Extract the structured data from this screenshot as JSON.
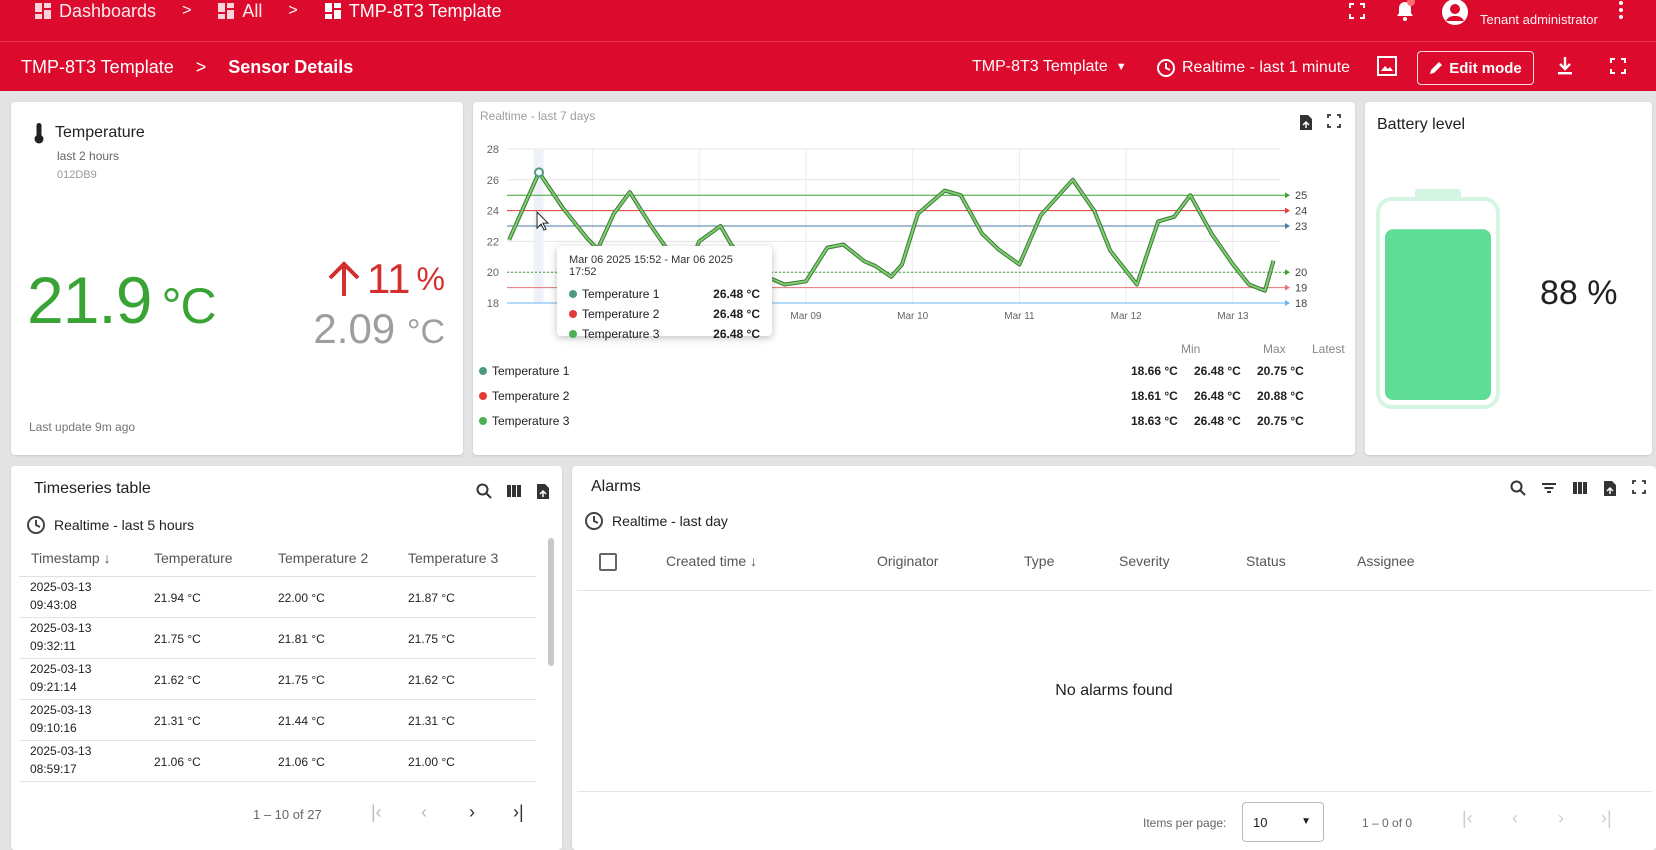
{
  "topbar": {
    "crumbs": [
      "Dashboards",
      "All",
      "TMP-8T3 Template"
    ],
    "user_role": "Tenant administrator"
  },
  "subbar": {
    "root": "TMP-8T3 Template",
    "current": "Sensor Details",
    "entity_select": "TMP-8T3 Template",
    "timewindow": "Realtime - last 1 minute",
    "edit_mode_label": "Edit mode"
  },
  "temperature_card": {
    "title": "Temperature",
    "subtitle": "last 2 hours",
    "device": "012DB9",
    "value": "21.9",
    "unit": "°C",
    "delta_percent": "11",
    "percent_sign": "%",
    "delta_abs": "2.09",
    "delta_unit": "°C",
    "last_update": "Last update 9m ago",
    "colors": {
      "value": "#3aa335",
      "delta": "#d32f2f"
    }
  },
  "chart_card": {
    "timewindow": "Realtime - last 7 days",
    "tooltip": {
      "title": "Mar 06 2025 15:52 - Mar 06 2025 17:52",
      "rows": [
        {
          "name": "Temperature 1",
          "value": "26.48 °C"
        },
        {
          "name": "Temperature 2",
          "value": "26.48 °C"
        },
        {
          "name": "Temperature 3",
          "value": "26.48 °C"
        }
      ]
    },
    "legend": {
      "headers": {
        "min": "Min",
        "max": "Max",
        "latest": "Latest"
      },
      "rows": [
        {
          "name": "Temperature 1",
          "min": "18.66 °C",
          "max": "26.48 °C",
          "latest": "20.75 °C",
          "color": "#4a9b7f"
        },
        {
          "name": "Temperature 2",
          "min": "18.61 °C",
          "max": "26.48 °C",
          "latest": "20.88 °C",
          "color": "#e53935"
        },
        {
          "name": "Temperature 3",
          "min": "18.63 °C",
          "max": "26.48 °C",
          "latest": "20.75 °C",
          "color": "#4caf50"
        }
      ]
    }
  },
  "chart_data": {
    "type": "line",
    "title": "",
    "xlabel": "",
    "ylabel": "",
    "ylim": [
      18,
      28
    ],
    "y_ticks": [
      "18",
      "20",
      "22",
      "24",
      "26",
      "28"
    ],
    "x_ticks": [
      "Mar 09",
      "Mar 10",
      "Mar 11",
      "Mar 12",
      "Mar 13"
    ],
    "x_tick_days": [
      9,
      10,
      11,
      12,
      13
    ],
    "x_range": [
      6.2,
      13.45
    ],
    "grid": true,
    "series": [
      {
        "name": "Temperature 1",
        "color": "#4a9b7f",
        "x": [
          6.22,
          6.5,
          6.72,
          6.95,
          7.05,
          7.2,
          7.35,
          7.55,
          7.75,
          7.85,
          8.0,
          8.2,
          8.3,
          8.45,
          8.6,
          8.8,
          9.0,
          9.2,
          9.35,
          9.55,
          9.65,
          9.8,
          9.9,
          10.05,
          10.3,
          10.45,
          10.65,
          10.8,
          11.0,
          11.2,
          11.5,
          11.7,
          11.85,
          12.1,
          12.3,
          12.45,
          12.6,
          12.8,
          13.0,
          13.15,
          13.3,
          13.38
        ],
        "y": [
          22.1,
          26.48,
          24.2,
          22.2,
          21.5,
          23.8,
          25.2,
          23.0,
          21.0,
          19.5,
          22.0,
          23.0,
          21.8,
          20.6,
          19.8,
          19.2,
          19.4,
          21.6,
          21.8,
          20.7,
          20.4,
          19.7,
          20.5,
          23.8,
          25.3,
          25.0,
          22.5,
          21.5,
          20.5,
          23.7,
          26.0,
          24.0,
          21.4,
          19.2,
          23.3,
          23.6,
          25.0,
          22.5,
          20.5,
          19.2,
          18.8,
          20.75
        ]
      },
      {
        "name": "Temperature 2",
        "color": "#e53935",
        "y_ref": 24,
        "right_label": "24"
      }
    ],
    "reference_lines": [
      {
        "value": 25,
        "label": "25",
        "color": "#3aa335"
      },
      {
        "value": 24,
        "label": "24",
        "color": "#e53935"
      },
      {
        "value": 23,
        "label": "23",
        "color": "#4a7aa5"
      },
      {
        "value": 20,
        "label": "20",
        "color": "#3aa335",
        "dashed": true
      },
      {
        "value": 19,
        "label": "19",
        "color": "#e57373"
      },
      {
        "value": 18,
        "label": "18",
        "color": "#64b5f6"
      }
    ]
  },
  "battery_card": {
    "title": "Battery level",
    "value": "88 %",
    "level": 0.88,
    "color": "#5fdc95"
  },
  "timeseries_table": {
    "title": "Timeseries table",
    "timewindow": "Realtime - last 5 hours",
    "columns": [
      "Timestamp",
      "Temperature",
      "Temperature 2",
      "Temperature 3"
    ],
    "rows": [
      {
        "ts1": "2025-03-13",
        "ts2": "09:43:08",
        "t1": "21.94 °C",
        "t2": "22.00 °C",
        "t3": "21.87 °C"
      },
      {
        "ts1": "2025-03-13",
        "ts2": "09:32:11",
        "t1": "21.75 °C",
        "t2": "21.81 °C",
        "t3": "21.75 °C"
      },
      {
        "ts1": "2025-03-13",
        "ts2": "09:21:14",
        "t1": "21.62 °C",
        "t2": "21.75 °C",
        "t3": "21.62 °C"
      },
      {
        "ts1": "2025-03-13",
        "ts2": "09:10:16",
        "t1": "21.31 °C",
        "t2": "21.44 °C",
        "t3": "21.31 °C"
      },
      {
        "ts1": "2025-03-13",
        "ts2": "08:59:17",
        "t1": "21.06 °C",
        "t2": "21.06 °C",
        "t3": "21.00 °C"
      }
    ],
    "range": "1 – 10 of 27"
  },
  "alarms": {
    "title": "Alarms",
    "timewindow": "Realtime - last day",
    "columns": [
      "Created time",
      "Originator",
      "Type",
      "Severity",
      "Status",
      "Assignee"
    ],
    "empty": "No alarms found",
    "items_per_page_label": "Items per page:",
    "items_per_page": "10",
    "range": "1 – 0 of 0"
  }
}
